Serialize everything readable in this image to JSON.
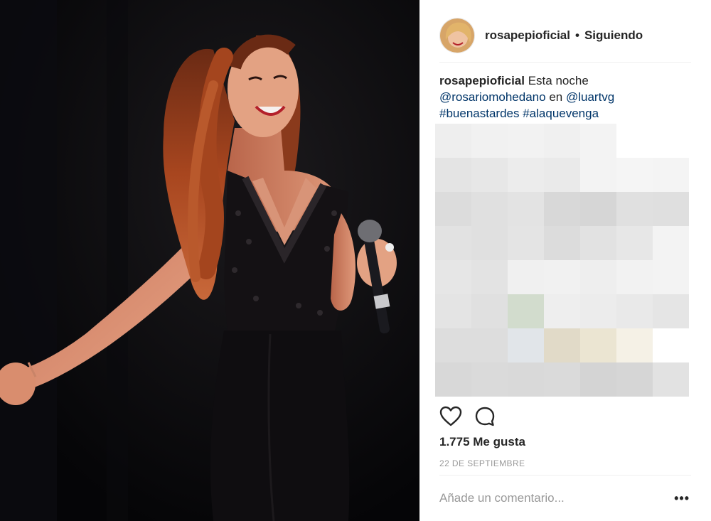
{
  "post": {
    "username": "rosapepioficial",
    "separator": "•",
    "follow_status": "Siguiendo",
    "caption": {
      "username": "rosapepioficial",
      "text": "Esta noche",
      "mention_1": "@rosariomohedano",
      "connector": "en",
      "mention_2": "@luartvg",
      "hashtag_1": "#buenastardes",
      "hashtag_2": "#alaquevenga"
    },
    "likes_label": "1.775 Me gusta",
    "date": "22 DE SEPTIEMBRE",
    "comment_placeholder": "Añade un comentario...",
    "more_label": "•••"
  },
  "pixelated_palette": [
    [
      "#eeeeee",
      "#f1f1f1",
      "#f2f2f2",
      "#f0f0f0",
      "#f3f3f3",
      "#ffffff",
      "#ffffff"
    ],
    [
      "#e4e4e4",
      "#e7e7e7",
      "#ececec",
      "#eaeaea",
      "#f3f3f3",
      "#f5f5f5",
      "#f4f4f4"
    ],
    [
      "#dcdcdc",
      "#e0e0e0",
      "#e3e3e3",
      "#d8d8d8",
      "#d6d6d6",
      "#e0e0e0",
      "#dfdfdf"
    ],
    [
      "#e2e2e2",
      "#e0e0e0",
      "#e4e4e4",
      "#dcdcdc",
      "#e2e2e2",
      "#e7e7e7",
      "#f3f3f3"
    ],
    [
      "#e6e6e6",
      "#e3e3e3",
      "#f0f0f0",
      "#f1f1f1",
      "#eeeeee",
      "#f2f2f2",
      "#f3f3f3"
    ],
    [
      "#e4e4e4",
      "#e0e0e0",
      "#d2dccd",
      "#eeeeee",
      "#ececec",
      "#e9e9e9",
      "#e5e5e5"
    ],
    [
      "#dddddd",
      "#dddddd",
      "#e1e5e9",
      "#e1dac8",
      "#ebe5d2",
      "#f5f1e6",
      "#ffffff"
    ],
    [
      "#d8d8d8",
      "#dadada",
      "#d9d9d9",
      "#dadada",
      "#d4d4d4",
      "#d6d6d6",
      "#e2e2e2"
    ]
  ]
}
